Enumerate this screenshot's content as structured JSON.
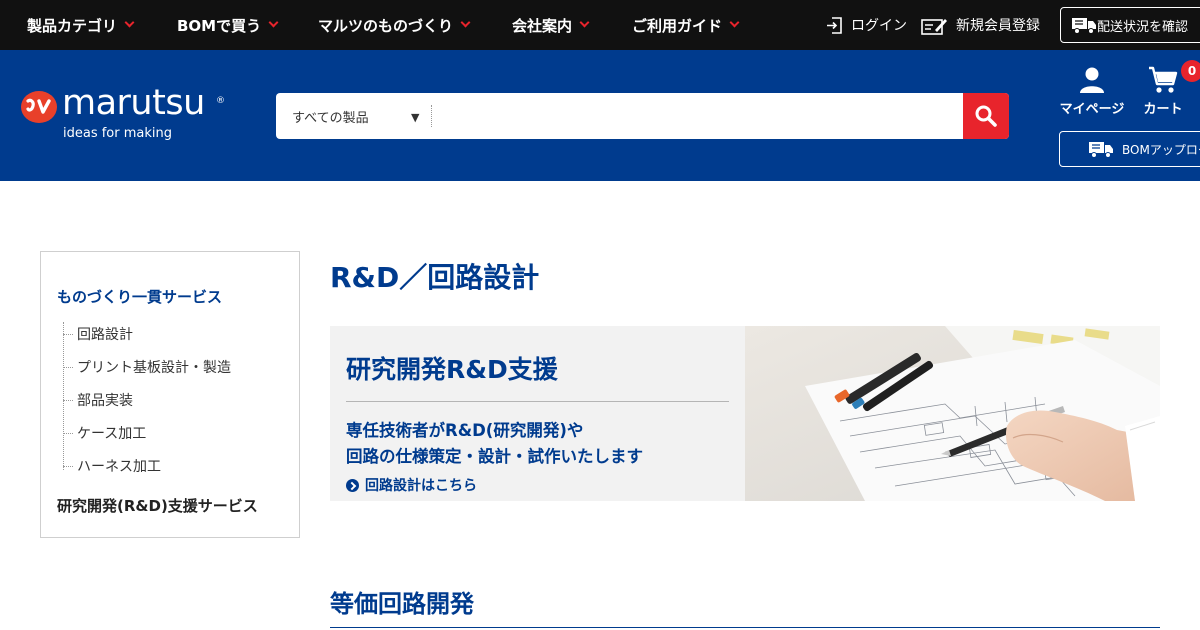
{
  "topbar": {
    "nav": [
      {
        "label": "製品カテゴリ"
      },
      {
        "label": "BOMで買う"
      },
      {
        "label": "マルツのものづくり"
      },
      {
        "label": "会社案内"
      },
      {
        "label": "ご利用ガイド"
      }
    ],
    "login_label": "ログイン",
    "register_label": "新規会員登録",
    "delivery_label": "配送状況を確認"
  },
  "header": {
    "logo_word": "marutsu",
    "logo_reg": "®",
    "logo_tagline": "ideas for making",
    "search": {
      "category_selected": "すべての製品",
      "caret": "▼",
      "input_value": "",
      "input_placeholder": ""
    },
    "mypage_label": "マイページ",
    "cart_label": "カート",
    "cart_count": "0",
    "bom_label": "BOMアップロード"
  },
  "sidebar": {
    "heading": "ものづくり一貫サービス",
    "items": [
      {
        "label": "回路設計"
      },
      {
        "label": "プリント基板設計・製造"
      },
      {
        "label": "部品実装"
      },
      {
        "label": "ケース加工"
      },
      {
        "label": "ハーネス加工"
      }
    ],
    "footer": "研究開発(R&D)支援サービス"
  },
  "main": {
    "page_title": "R&D／回路設計",
    "banner": {
      "title": "研究開発R&D支援",
      "desc_line1": "専任技術者がR&D(研究開発)や",
      "desc_line2": "回路の仕様策定・設計・試作いたします",
      "link_label": "回路設計はこちら"
    },
    "section_title": "等価回路開発"
  },
  "colors": {
    "brand_blue": "#003b8e",
    "accent_red": "#e8242c",
    "topbar_black": "#111111",
    "banner_gray": "#f2f2f2"
  },
  "icons": [
    "chevron-down-icon",
    "login-icon",
    "register-icon",
    "truck-icon",
    "search-icon",
    "user-icon",
    "cart-icon",
    "arrow-circle-icon"
  ]
}
